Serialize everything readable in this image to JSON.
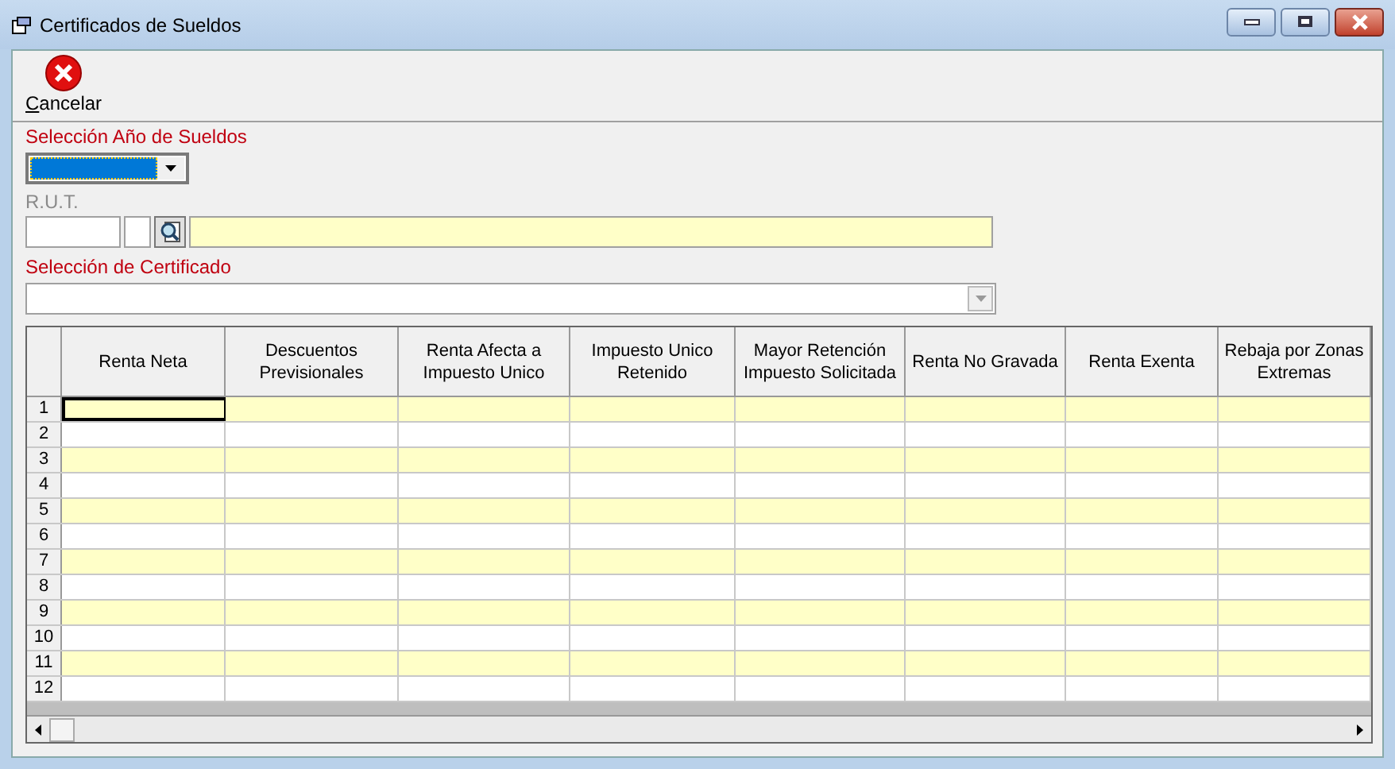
{
  "window": {
    "title": "Certificados de Sueldos"
  },
  "toolbar": {
    "buttons": [
      {
        "label": "Cancelar",
        "mnemonic_underlined": true
      }
    ]
  },
  "year_select": {
    "label": "Selección Año de Sueldos",
    "highlighted": true
  },
  "rut": {
    "label": "R.U.T.",
    "disabled": true
  },
  "certificate_select": {
    "label": "Selección de Certificado",
    "disabled": true
  },
  "table": {
    "columns": [
      "Renta Neta",
      "Descuentos Previsionales",
      "Renta Afecta a Impuesto Unico",
      "Impuesto Unico Retenido",
      "Mayor Retención Impuesto Solicitada",
      "Renta No Gravada",
      "Renta Exenta",
      "Rebaja por Zonas Extremas"
    ],
    "rows": [
      {
        "label": "1",
        "cell_selected": true
      },
      {
        "label": "2",
        "cell_selected": false
      },
      {
        "label": "3",
        "cell_selected": false
      },
      {
        "label": "4",
        "cell_selected": false
      },
      {
        "label": "5",
        "cell_selected": false
      },
      {
        "label": "6",
        "cell_selected": false
      },
      {
        "label": "7",
        "cell_selected": false
      },
      {
        "label": "8",
        "cell_selected": false
      },
      {
        "label": "9",
        "cell_selected": false
      },
      {
        "label": "10",
        "cell_selected": false
      },
      {
        "label": "11",
        "cell_selected": false
      },
      {
        "label": "12",
        "cell_selected": false
      }
    ]
  }
}
